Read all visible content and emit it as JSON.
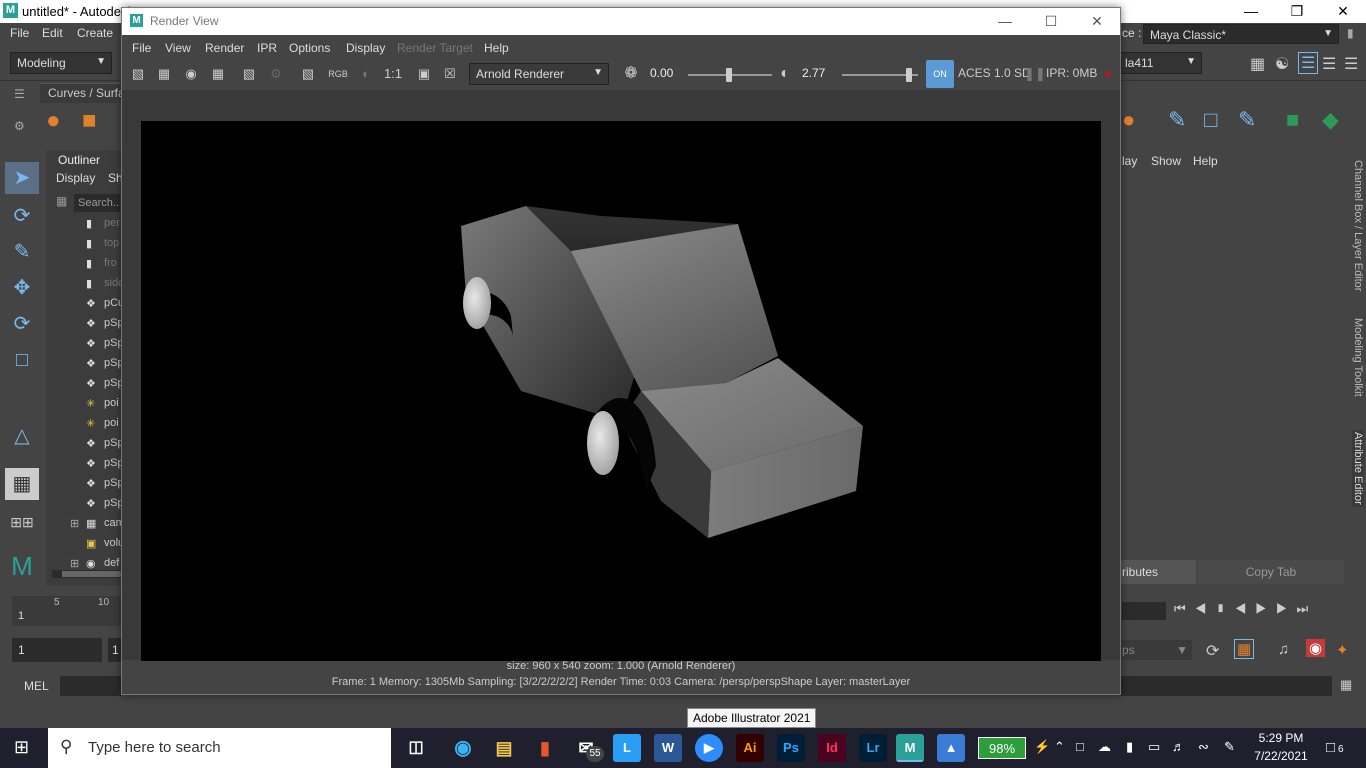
{
  "maya": {
    "title": "untitled* - Autodesk",
    "menu": [
      "File",
      "Edit",
      "Create"
    ],
    "workspace_label": "ce :",
    "workspace_value": "Maya Classic*",
    "mode": "Modeling",
    "shelf_tab": "Curves / Surfa",
    "right_dropdown": "la411",
    "outliner": {
      "title": "Outliner",
      "menus": [
        "Display",
        "Sh"
      ],
      "search_placeholder": "Search...",
      "items": [
        "per",
        "top",
        "fro",
        "side",
        "pCu",
        "pSp",
        "pSp",
        "pSp",
        "pSp",
        "poi",
        "poi",
        "pSp",
        "pSp",
        "pSp",
        "pSp",
        "cam",
        "volu",
        "def"
      ]
    },
    "right_panel": {
      "menus": [
        "lay",
        "Show",
        "Help"
      ],
      "vertical_tabs": [
        "Channel Box / Layer Editor",
        "Modeling Toolkit",
        "Attribute Editor"
      ],
      "bottom_tabs": [
        "ributes",
        "Copy Tab"
      ]
    },
    "timeslider": {
      "ticks": [
        "5",
        "10"
      ],
      "current": "1"
    },
    "range": {
      "start": "1",
      "start2": "1",
      "fps": "ps"
    },
    "cmd_label": "MEL"
  },
  "render_view": {
    "title": "Render View",
    "menu": [
      "File",
      "View",
      "Render",
      "IPR",
      "Options",
      "Display",
      "Render Target",
      "Help"
    ],
    "renderer": "Arnold Renderer",
    "exposure": "0.00",
    "gamma": "2.77",
    "ratio": "1:1",
    "rgb": "RGB",
    "color_space": "ACES 1.0 SD",
    "ipr_mem": "IPR: 0MB",
    "status_line1": "size: 960 x 540 zoom: 1.000     (Arnold Renderer)",
    "status_line2": "Frame: 1    Memory: 1305Mb    Sampling: [3/2/2/2/2/2]    Render Time: 0:03    Camera: /persp/perspShape    Layer: masterLayer"
  },
  "tooltip": "Adobe Illustrator 2021",
  "taskbar": {
    "search_placeholder": "Type here to search",
    "mail_badge": "55",
    "apps": [
      "L",
      "Ai",
      "Ps",
      "Id",
      "Lr",
      "M"
    ],
    "battery": "98%",
    "time": "5:29 PM",
    "date": "7/22/2021",
    "notifications": "6"
  },
  "colors": {
    "maya_teal": "#2aa198",
    "accent_blue": "#5b9bd5",
    "battery_green": "#2d9e3a"
  }
}
